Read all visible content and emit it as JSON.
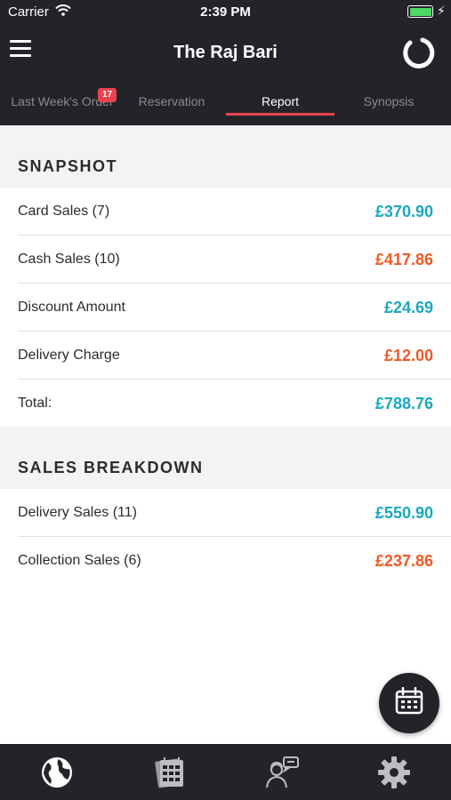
{
  "status_bar": {
    "carrier": "Carrier",
    "time": "2:39 PM",
    "battery_color": "#4cd964"
  },
  "header": {
    "title": "The Raj Bari",
    "menu_icon": "hamburger-menu-icon",
    "logo_icon": "app-logo-icon"
  },
  "tabs": [
    {
      "label": "Last Week's Order",
      "badge": "17",
      "active": false
    },
    {
      "label": "Reservation",
      "active": false
    },
    {
      "label": "Report",
      "active": true
    },
    {
      "label": "Synopsis",
      "active": false
    }
  ],
  "snapshot": {
    "title": "SNAPSHOT",
    "rows": [
      {
        "label": "Card Sales (7)",
        "value": "£370.90",
        "color": "#19a9bc"
      },
      {
        "label": "Cash Sales (10)",
        "value": "£417.86",
        "color": "#f05a24"
      },
      {
        "label": "Discount Amount",
        "value": "£24.69",
        "color": "#19a9bc"
      },
      {
        "label": "Delivery Charge",
        "value": "£12.00",
        "color": "#f05a24"
      },
      {
        "label": "Total:",
        "value": "£788.76",
        "color": "#19a9bc"
      }
    ]
  },
  "sales_breakdown": {
    "title": "SALES BREAKDOWN",
    "rows": [
      {
        "label": "Delivery Sales (11)",
        "value": "£550.90",
        "color": "#19a9bc"
      },
      {
        "label": "Collection Sales (6)",
        "value": "£237.86",
        "color": "#f05a24"
      }
    ]
  },
  "fab": {
    "icon": "calendar-icon"
  },
  "bottom_nav": [
    {
      "icon": "globe-icon"
    },
    {
      "icon": "calendar-book-icon"
    },
    {
      "icon": "support-agent-icon"
    },
    {
      "icon": "gear-icon"
    }
  ],
  "colors": {
    "bar_background": "#24232a",
    "accent_red": "#e8424e",
    "teal": "#19a9bc",
    "orange": "#f05a24"
  }
}
